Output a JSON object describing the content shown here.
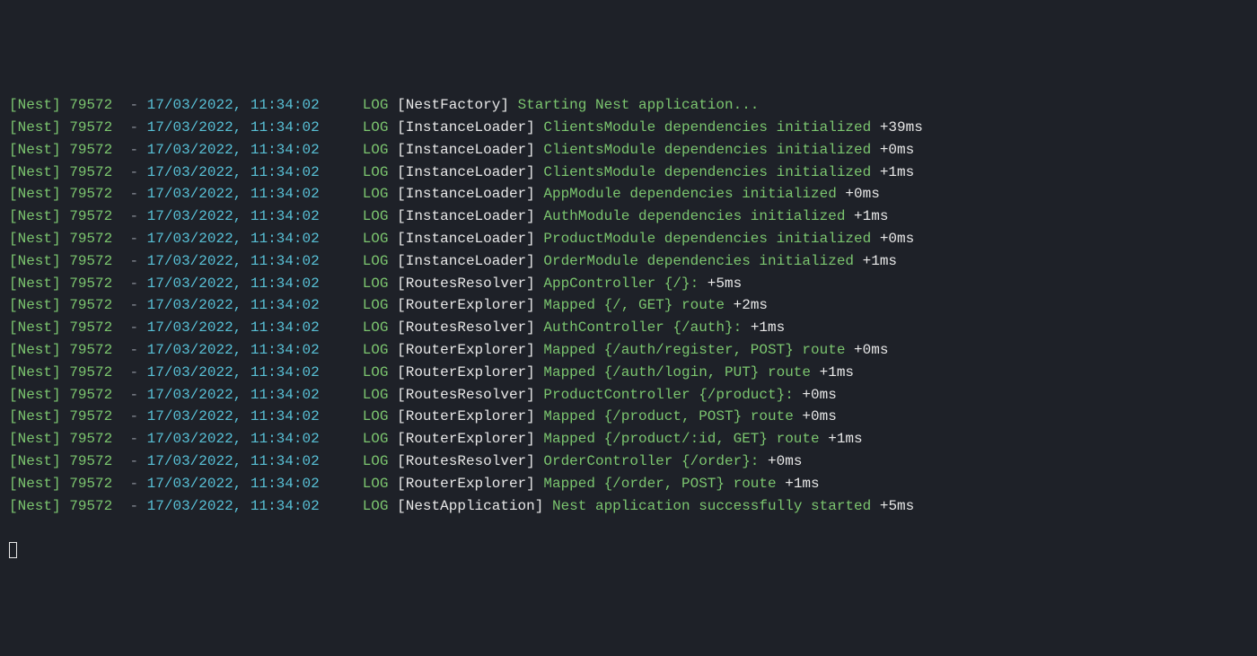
{
  "framework_tag": "[Nest]",
  "pid": "79572",
  "separator": "-",
  "timestamp": "17/03/2022, 11:34:02",
  "level": "LOG",
  "lines": [
    {
      "context": "[NestFactory]",
      "message": "Starting Nest application...",
      "timing": ""
    },
    {
      "context": "[InstanceLoader]",
      "message": "ClientsModule dependencies initialized",
      "timing": "+39ms"
    },
    {
      "context": "[InstanceLoader]",
      "message": "ClientsModule dependencies initialized",
      "timing": "+0ms"
    },
    {
      "context": "[InstanceLoader]",
      "message": "ClientsModule dependencies initialized",
      "timing": "+1ms"
    },
    {
      "context": "[InstanceLoader]",
      "message": "AppModule dependencies initialized",
      "timing": "+0ms"
    },
    {
      "context": "[InstanceLoader]",
      "message": "AuthModule dependencies initialized",
      "timing": "+1ms"
    },
    {
      "context": "[InstanceLoader]",
      "message": "ProductModule dependencies initialized",
      "timing": "+0ms"
    },
    {
      "context": "[InstanceLoader]",
      "message": "OrderModule dependencies initialized",
      "timing": "+1ms"
    },
    {
      "context": "[RoutesResolver]",
      "message": "AppController {/}:",
      "timing": "+5ms"
    },
    {
      "context": "[RouterExplorer]",
      "message": "Mapped {/, GET} route",
      "timing": "+2ms"
    },
    {
      "context": "[RoutesResolver]",
      "message": "AuthController {/auth}:",
      "timing": "+1ms"
    },
    {
      "context": "[RouterExplorer]",
      "message": "Mapped {/auth/register, POST} route",
      "timing": "+0ms"
    },
    {
      "context": "[RouterExplorer]",
      "message": "Mapped {/auth/login, PUT} route",
      "timing": "+1ms"
    },
    {
      "context": "[RoutesResolver]",
      "message": "ProductController {/product}:",
      "timing": "+0ms"
    },
    {
      "context": "[RouterExplorer]",
      "message": "Mapped {/product, POST} route",
      "timing": "+0ms"
    },
    {
      "context": "[RouterExplorer]",
      "message": "Mapped {/product/:id, GET} route",
      "timing": "+1ms"
    },
    {
      "context": "[RoutesResolver]",
      "message": "OrderController {/order}:",
      "timing": "+0ms"
    },
    {
      "context": "[RouterExplorer]",
      "message": "Mapped {/order, POST} route",
      "timing": "+1ms"
    },
    {
      "context": "[NestApplication]",
      "message": "Nest application successfully started",
      "timing": "+5ms"
    }
  ]
}
